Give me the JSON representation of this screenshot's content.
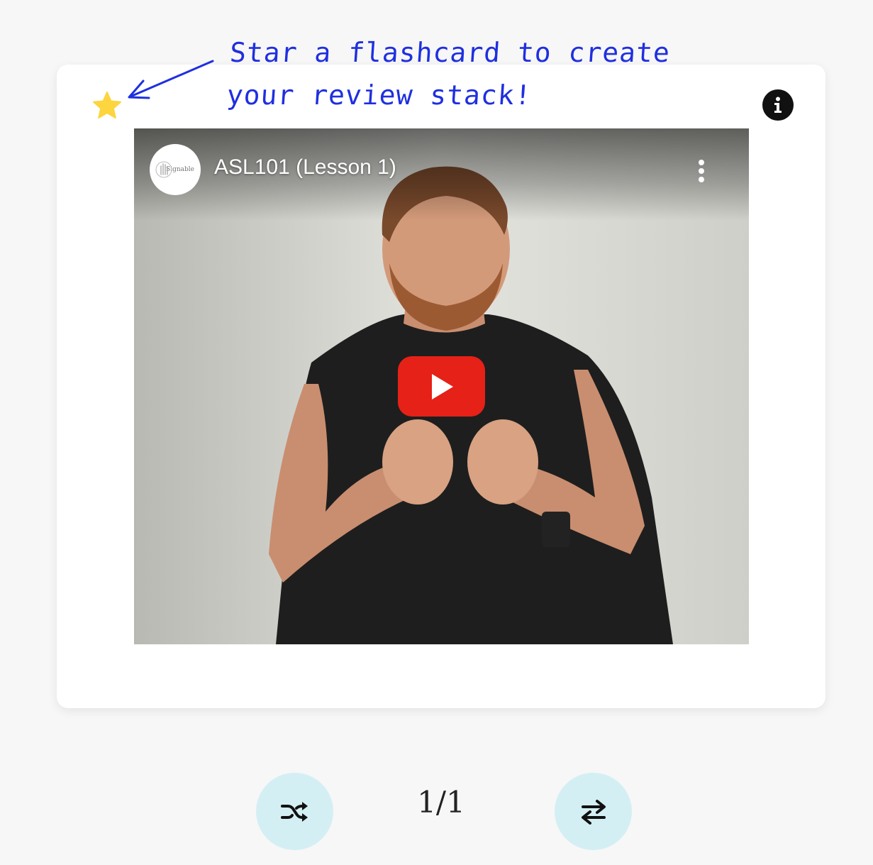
{
  "annotation": {
    "line1": "Star a flashcard to create",
    "line2": "your review stack!",
    "color": "#1f2fe0"
  },
  "card": {
    "star_icon": "star-icon",
    "star_color": "#fcd53f",
    "info_icon": "info-icon"
  },
  "video": {
    "title": "ASL101 (Lesson 1)",
    "channel_logo_text": "Signable",
    "play_icon": "youtube-play-icon",
    "menu_icon": "more-vertical-icon"
  },
  "controls": {
    "shuffle_icon": "shuffle-icon",
    "counter": "1/1",
    "flip_icon": "swap-arrows-icon",
    "button_color": "#d4eff3"
  }
}
